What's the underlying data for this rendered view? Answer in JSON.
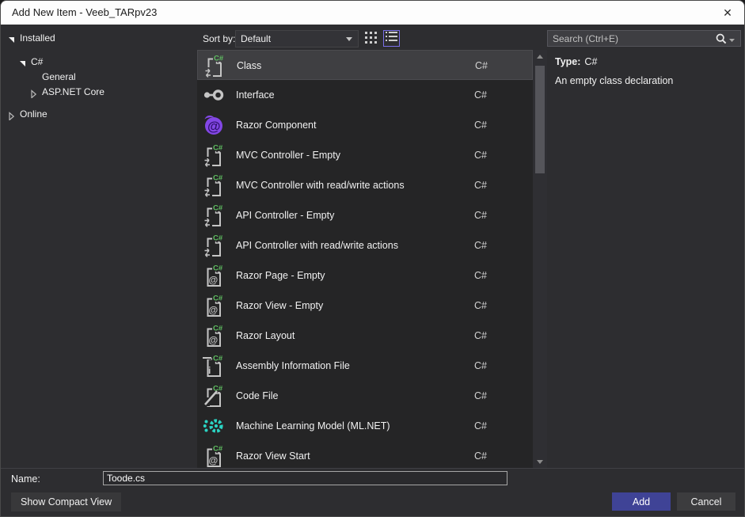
{
  "window": {
    "title": "Add New Item - Veeb_TARpv23",
    "close_glyph": "✕"
  },
  "sidebar": {
    "items": [
      {
        "label": "Installed",
        "glyph": "expanded",
        "level": 0
      },
      {
        "label": "C#",
        "glyph": "expanded",
        "level": 1
      },
      {
        "label": "General",
        "glyph": "none",
        "level": 2
      },
      {
        "label": "ASP.NET Core",
        "glyph": "collapsed",
        "level": 2
      },
      {
        "label": "Online",
        "glyph": "collapsed",
        "level": 0
      }
    ]
  },
  "toolbar": {
    "sort_by_label": "Sort by:",
    "sort_value": "Default",
    "view_modes": [
      "grid-view",
      "list-view"
    ],
    "selected_view": "list-view"
  },
  "search": {
    "placeholder": "Search (Ctrl+E)"
  },
  "template_list": {
    "items": [
      {
        "name": "Class",
        "language": "C#",
        "icon": "csharp-class",
        "selected": true
      },
      {
        "name": "Interface",
        "language": "C#",
        "icon": "interface",
        "selected": false
      },
      {
        "name": "Razor Component",
        "language": "C#",
        "icon": "razor-component",
        "selected": false
      },
      {
        "name": "MVC Controller - Empty",
        "language": "C#",
        "icon": "csharp-class",
        "selected": false
      },
      {
        "name": "MVC Controller with read/write actions",
        "language": "C#",
        "icon": "csharp-class",
        "selected": false
      },
      {
        "name": "API Controller - Empty",
        "language": "C#",
        "icon": "csharp-class",
        "selected": false
      },
      {
        "name": "API Controller with read/write actions",
        "language": "C#",
        "icon": "csharp-class",
        "selected": false
      },
      {
        "name": "Razor Page - Empty",
        "language": "C#",
        "icon": "razor-file",
        "selected": false
      },
      {
        "name": "Razor View - Empty",
        "language": "C#",
        "icon": "razor-file",
        "selected": false
      },
      {
        "name": "Razor Layout",
        "language": "C#",
        "icon": "razor-file",
        "selected": false
      },
      {
        "name": "Assembly Information File",
        "language": "C#",
        "icon": "assembly-info",
        "selected": false
      },
      {
        "name": "Code File",
        "language": "C#",
        "icon": "code-file",
        "selected": false
      },
      {
        "name": "Machine Learning Model (ML.NET)",
        "language": "C#",
        "icon": "mlnet",
        "selected": false
      },
      {
        "name": "Razor View Start",
        "language": "C#",
        "icon": "razor-file",
        "selected": false
      }
    ]
  },
  "details": {
    "type_label": "Type:",
    "type_value": "C#",
    "description": "An empty class declaration"
  },
  "footer": {
    "name_label": "Name:",
    "name_value": "Toode.cs",
    "compact_view_button": "Show Compact View",
    "add_button": "Add",
    "cancel_button": "Cancel"
  },
  "colors": {
    "accent_button": "#3f4396",
    "selected_view_border": "#7a6fe8",
    "csharp_badge_green": "#5fbf61",
    "razor_purple": "#8347e6",
    "mlnet_teal": "#2bd4c3",
    "selected_row": "#3f3f42",
    "list_background": "#252526",
    "dialog_background": "#2d2d30",
    "titlebar_background": "#fdfdfd"
  }
}
